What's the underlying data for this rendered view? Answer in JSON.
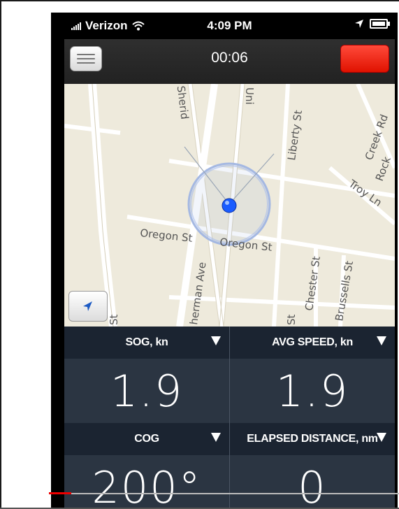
{
  "status_bar": {
    "carrier": "Verizon",
    "time": "4:09 PM"
  },
  "nav_bar": {
    "timer": "00:06"
  },
  "map": {
    "street_labels": {
      "oregon_west": "Oregon St",
      "oregon_east": "Oregon St",
      "sherman": "herman Ave",
      "sheridan": "Sherid",
      "union": "Uni",
      "liberty": "Liberty St",
      "troy": "Troy Ln",
      "rock_creek": "Creek Rd",
      "rock": "Rock",
      "chester": "Chester St",
      "brussells": "Brussells St",
      "st_left": "St",
      "st_mid": "St"
    }
  },
  "stats": {
    "cells": [
      {
        "label": "SOG, kn",
        "value": "1.9"
      },
      {
        "label": "AVG SPEED, kn",
        "value": "1.9"
      },
      {
        "label": "COG",
        "value": "200°"
      },
      {
        "label": "ELAPSED DISTANCE, nm",
        "value": "0"
      }
    ]
  },
  "icons": [
    "wifi-icon",
    "location-arrow-icon",
    "battery-icon",
    "menu-icon",
    "stop-icon",
    "locate-icon",
    "caret-down-icon"
  ],
  "colors": {
    "map_bg": "#eeeadc",
    "stop_red": "#ff2a10",
    "stats_bg": "#2b3542",
    "header_bg": "#1b2431",
    "location_dot": "#1a5cff"
  }
}
